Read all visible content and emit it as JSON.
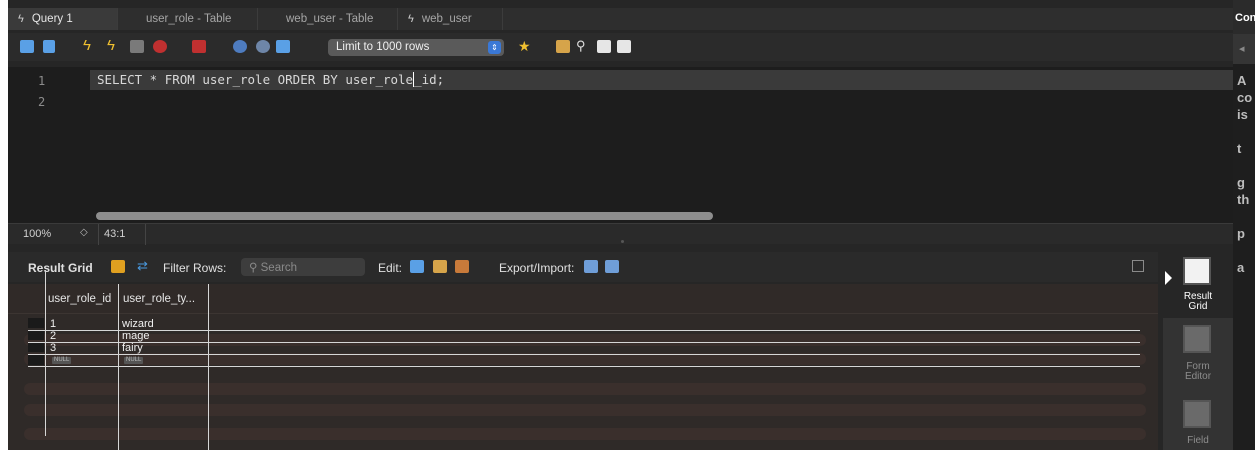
{
  "tabs": [
    {
      "label": "Query 1",
      "icon": "bolt-icon"
    },
    {
      "label": "user_role - Table"
    },
    {
      "label": "web_user - Table"
    },
    {
      "label": "web_user",
      "icon": "bolt-icon"
    }
  ],
  "right_panel": {
    "header": "Con",
    "sub": "◂",
    "text": "A\nco\nis\n\nt\n\ng\nth\n\np\n\na"
  },
  "toolbar": {
    "limit_select": "Limit to 1000 rows",
    "icons": [
      "open-folder-icon",
      "save-icon",
      "execute-icon",
      "execute-current-icon",
      "explain-icon",
      "stop-icon",
      "toggle-error-icon",
      "commit-icon",
      "rollback-icon",
      "autocommit-icon",
      "bookmark-icon",
      "beautify-icon",
      "find-icon",
      "invisible-chars-icon",
      "wrap-icon"
    ]
  },
  "editor": {
    "lines": [
      "1",
      "2"
    ],
    "code_before_caret": "SELECT * FROM user_role ORDER BY user_role",
    "code_after_caret": "_id;"
  },
  "status": {
    "zoom": "100%",
    "cursor_position": "43:1"
  },
  "result_toolbar": {
    "title": "Result Grid",
    "filter_label": "Filter Rows:",
    "search_placeholder": "Search",
    "edit_label": "Edit:",
    "export_label": "Export/Import:"
  },
  "grid": {
    "columns": [
      "user_role_id",
      "user_role_ty..."
    ],
    "rows": [
      {
        "id": "1",
        "type": "wizard"
      },
      {
        "id": "2",
        "type": "mage"
      },
      {
        "id": "3",
        "type": "fairy"
      }
    ],
    "null_text": "NULL"
  },
  "side_panel": [
    {
      "label_line1": "Result",
      "label_line2": "Grid"
    },
    {
      "label_line1": "Form",
      "label_line2": "Editor"
    },
    {
      "label_line1": "Field",
      "label_line2": ""
    }
  ]
}
